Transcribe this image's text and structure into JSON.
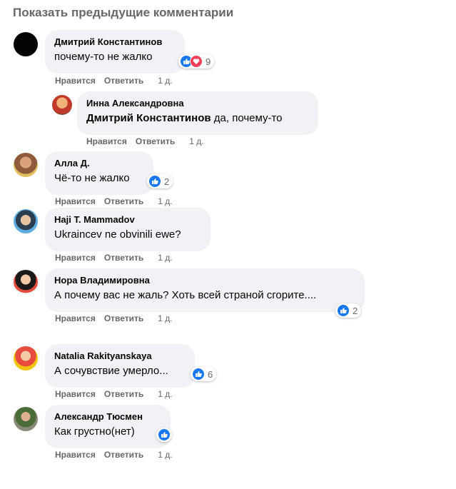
{
  "show_previous": "Показать предыдущие комментарии",
  "actions": {
    "like": "Нравится",
    "reply": "Ответить"
  },
  "colors": {
    "bubble": "#f0f2f5",
    "like": "#1877f2",
    "love": "#f33e58",
    "meta_text": "#65676b"
  },
  "comments": [
    {
      "author": "Дмитрий Константинов",
      "text": "почему-то не жалко",
      "reaction_count": "9",
      "reaction_icons": [
        "like-icon",
        "love-icon"
      ],
      "time": "1 д."
    },
    {
      "author": "Инна Александровна",
      "mention": "Дмитрий Константинов",
      "text": "да, почему-то",
      "time": "1 д."
    },
    {
      "author": "Алла Д.",
      "text": "Чё-то не жалко",
      "reaction_count": "2",
      "reaction_icons": [
        "like-icon"
      ],
      "time": "1 д."
    },
    {
      "author": "Haji T. Mammadov",
      "text": "Ukraincev ne obvinili ewe?",
      "time": "1 д."
    },
    {
      "author": "Нора Владимировна",
      "text": "А почему вас не жаль? Хоть всей страной сгорите....",
      "reaction_count": "2",
      "reaction_icons": [
        "like-icon"
      ],
      "time": "1 д."
    },
    {
      "author": "Natalia Rakityanskaya",
      "text": "А сочувствие умерло...",
      "reaction_count": "6",
      "reaction_icons": [
        "like-icon"
      ],
      "time": "1 д."
    },
    {
      "author": "Александр Тюсмен",
      "text": "Как грустно(нет)",
      "reaction_icons": [
        "like-icon"
      ],
      "time": "1 д."
    }
  ]
}
